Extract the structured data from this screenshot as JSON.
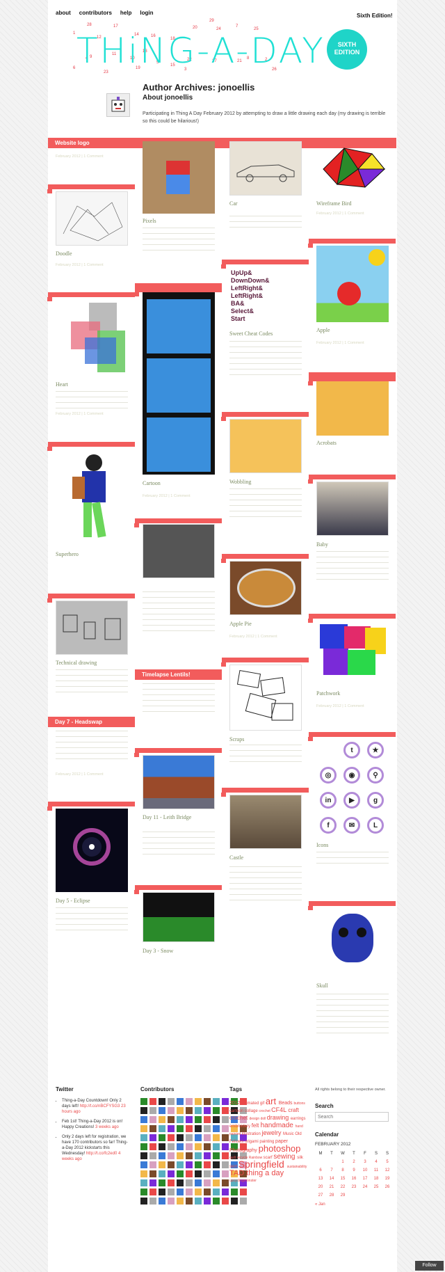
{
  "header": {
    "nav": [
      "about",
      "contributors",
      "help",
      "login"
    ],
    "edition_link": "Sixth Edition!",
    "logo": "THiNG-A-DAY",
    "badge_line1": "SIXTH",
    "badge_line2": "EDITION",
    "date_numbers": [
      "1",
      "28",
      "12",
      "17",
      "14",
      "16",
      "18",
      "20",
      "29",
      "24",
      "4",
      "11",
      "13",
      "10",
      "22",
      "5",
      "8",
      "6",
      "9",
      "23",
      "19",
      "15",
      "3",
      "27",
      "21",
      "2",
      "26",
      "7",
      "25"
    ]
  },
  "archive": {
    "title": "Author Archives: jonoellis",
    "about": "About jonoellis",
    "bio": "Participating in Thing A Day February 2012 by attempting to draw a little drawing each day (my drawing is terrible so this could be hilarious!)"
  },
  "posts": {
    "website_logo": "Website logo",
    "doodle": "Doodle",
    "heart": "Heart",
    "superhero": "Superhero",
    "technical_drawing": "Technical drawing",
    "headswap": "Day 7 - Headswap",
    "eclipse": "Day 5 - Eclipse",
    "pixels": "Pixels",
    "cartoon": "Cartoon",
    "timelapse": "Timelapse Lentils!",
    "leith": "Day 11 - Leith Bridge",
    "snow": "Day 3 - Snow",
    "car": "Car",
    "updown": "Sweet Cheat Codes",
    "wobbling": "Wobbling",
    "pie": "Apple Pie",
    "scraps": "Scraps",
    "castle": "Castle",
    "bird": "Wireframe Bird",
    "apple": "Apple",
    "wobbling_act": "Acrobats",
    "baby": "Baby",
    "patchwork": "Patchwork",
    "icons": "Icons",
    "skull": "Skull"
  },
  "cheat_text": [
    "UpUp&",
    "DownDown&",
    "LeftRight&",
    "LeftRight&",
    "BA&",
    "Select&",
    "Start"
  ],
  "meta_text": "February 2012 | 1 Comment",
  "footer": {
    "twitter_h": "Twitter",
    "tweets": [
      {
        "text": "Thing-a-Day Countdown! Only 2 days left!",
        "link": "http://t.co/nBCFYSG3",
        "ago": "23 hours ago"
      },
      {
        "text": "Feb 1st! Thing-a-Day 2012 is on! Happy Creations!",
        "link": "",
        "ago": "3 weeks ago"
      },
      {
        "text": "Only 2 days left for registration, we have 170 contributors so far! Thing-a-Day 2012 kickstarts this Wednesday!",
        "link": "http://t.co/fc2ed0",
        "ago": "4 weeks ago"
      }
    ],
    "contributors_h": "Contributors",
    "tags_h": "Tags",
    "tags": [
      "2012",
      "animated gif",
      "art",
      "Beads",
      "buttons",
      "cartoon",
      "collage",
      "crochet",
      "CF4L",
      "craft",
      "crochet",
      "design",
      "doll",
      "drawing",
      "earrings",
      "embroidery",
      "felt",
      "handmade",
      "hand painted",
      "illustration",
      "jewelry",
      "Music",
      "Old Fellows",
      "origami",
      "painting",
      "paper",
      "Photography",
      "photoshop",
      "quilt",
      "recycle",
      "Rainbow",
      "scarf",
      "sewing",
      "silk",
      "skirt",
      "Springfield",
      "sustainability",
      "TAD",
      "thing a day",
      "upcyclingmonster"
    ],
    "rights": "All rights belong to their respective owner.",
    "search_h": "Search",
    "search_placeholder": "Search",
    "calendar_h": "Calendar",
    "calendar_month": "FEBRUARY 2012",
    "days": [
      "M",
      "T",
      "W",
      "T",
      "F",
      "S",
      "S"
    ],
    "prev": "« Jan",
    "follow": "Follow"
  }
}
